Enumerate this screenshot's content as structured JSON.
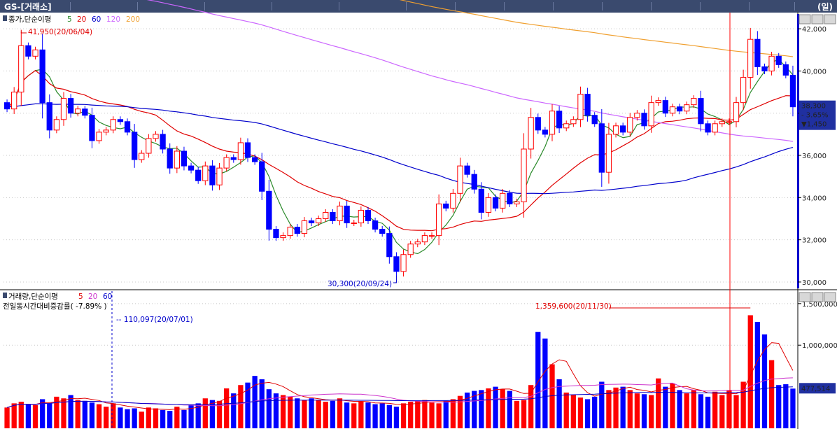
{
  "window": {
    "title": "GS-[거래소]",
    "period_label": "(일)"
  },
  "price_panel": {
    "legend_prefix": "종가,단순이평",
    "ma_labels": [
      "5",
      "20",
      "60",
      "120",
      "200"
    ],
    "ma_colors": [
      "#2a8a2a",
      "#e00000",
      "#0000cc",
      "#cc66ff",
      "#f0a030"
    ],
    "high_annotation": "41,950(20/06/04)",
    "low_annotation": "30,300(20/09/24)",
    "last_price": "38,300",
    "change_pct": "- 3.65%",
    "change_abs": "▼1,450",
    "y_ticks": [
      "42,000",
      "40,000",
      "38,000",
      "36,000",
      "34,000",
      "32,000",
      "30,000"
    ]
  },
  "volume_panel": {
    "legend_prefix": "거래량,단순이평",
    "ma_labels": [
      "5",
      "20",
      "60"
    ],
    "ma_colors": [
      "#e00000",
      "#cc33cc",
      "#0000cc"
    ],
    "subtitle": "전일동시간대비증감률( -7.89% )",
    "marker_annotation": "110,097(20/07/01)",
    "peak_annotation": "1,359,600(20/11/30)",
    "last_volume": "477,514",
    "y_ticks": [
      "1,500,000",
      "1,000,000"
    ]
  },
  "colors": {
    "up": "#ff0000",
    "down": "#0000ff",
    "crosshair": "#ff0000",
    "gridline": "#c8c8c8"
  },
  "chart_data": [
    {
      "type": "candlestick",
      "title": "GS-[거래소]",
      "ylim": [
        29700,
        42700
      ],
      "high": {
        "value": 41950,
        "date": "20/06/04"
      },
      "low": {
        "value": 30300,
        "date": "20/09/24"
      },
      "close": [
        38200,
        39000,
        41200,
        40700,
        41000,
        38500,
        37200,
        37700,
        38700,
        38000,
        38200,
        37900,
        36700,
        37100,
        37200,
        37700,
        37600,
        37100,
        35800,
        36100,
        36800,
        37000,
        36300,
        35400,
        36200,
        35500,
        35300,
        34800,
        35500,
        34600,
        35400,
        35900,
        35800,
        36600,
        35900,
        35700,
        34300,
        32500,
        32100,
        32200,
        32600,
        32300,
        32900,
        32800,
        33000,
        33300,
        32900,
        33600,
        32800,
        32800,
        33400,
        32900,
        32500,
        32300,
        31200,
        30500,
        31300,
        31800,
        31900,
        32200,
        32200,
        33700,
        33500,
        34200,
        35500,
        35100,
        34400,
        33300,
        34000,
        33500,
        34200,
        33700,
        33800,
        36300,
        37800,
        37200,
        37000,
        38100,
        37300,
        37500,
        37700,
        38900,
        37900,
        37500,
        35200,
        37000,
        37400,
        37100,
        37800,
        38000,
        37400,
        38500,
        38600,
        38000,
        38300,
        38100,
        38400,
        38700,
        37500,
        37100,
        37500,
        37600,
        37600,
        38500,
        39700,
        41500,
        40200,
        40000,
        40700,
        40300,
        39800,
        38300
      ],
      "ma_windows": [
        5,
        20,
        60,
        120,
        200
      ]
    },
    {
      "type": "bar",
      "title": "거래량",
      "ylim": [
        0,
        1650000
      ],
      "peak": {
        "value": 1359600,
        "date": "20/11/30"
      },
      "last_value": 477514,
      "values": [
        250000,
        300000,
        320000,
        290000,
        280000,
        350000,
        300000,
        380000,
        360000,
        400000,
        340000,
        330000,
        310000,
        290000,
        260000,
        300000,
        250000,
        230000,
        240000,
        200000,
        250000,
        240000,
        220000,
        210000,
        260000,
        220000,
        280000,
        300000,
        360000,
        340000,
        330000,
        480000,
        420000,
        520000,
        550000,
        630000,
        590000,
        470000,
        420000,
        400000,
        380000,
        360000,
        340000,
        360000,
        340000,
        320000,
        330000,
        360000,
        310000,
        300000,
        320000,
        310000,
        290000,
        300000,
        280000,
        260000,
        300000,
        320000,
        330000,
        340000,
        310000,
        300000,
        330000,
        350000,
        390000,
        430000,
        450000,
        460000,
        480000,
        500000,
        470000,
        450000,
        330000,
        340000,
        520000,
        1160000,
        1080000,
        770000,
        590000,
        430000,
        400000,
        370000,
        350000,
        380000,
        560000,
        460000,
        490000,
        500000,
        460000,
        420000,
        410000,
        400000,
        600000,
        500000,
        540000,
        460000,
        420000,
        460000,
        410000,
        380000,
        440000,
        400000,
        460000,
        400000,
        560000,
        1360000,
        1280000,
        1130000,
        820000,
        520000,
        530000,
        477514
      ]
    }
  ]
}
